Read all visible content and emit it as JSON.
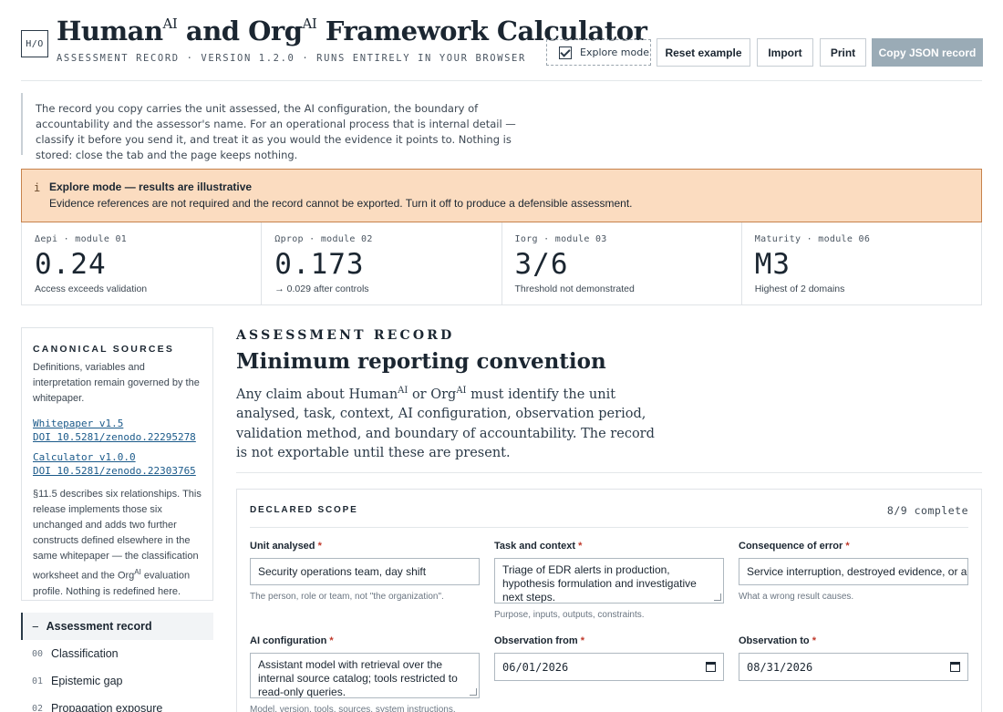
{
  "header": {
    "logo": "H/O",
    "title": {
      "part1": "Human",
      "sup1": "AI",
      "part2": " and Org",
      "sup2": "AI",
      "part3": " Framework Calculator"
    },
    "subtitle": "ASSESSMENT RECORD · VERSION 1.2.0 · RUNS ENTIRELY IN YOUR BROWSER",
    "explore_label": "Explore mode",
    "explore_checked": true,
    "reset_label": "Reset example",
    "import_label": "Import",
    "print_label": "Print",
    "copy_label": "Copy JSON record"
  },
  "intro": "The record you copy carries the unit assessed, the AI configuration, the boundary of accountability and the assessor's name. For an operational process that is internal detail — classify it before you send it, and treat it as you would the evidence it points to. Nothing is stored: close the tab and the page keeps nothing.",
  "warning": {
    "icon": "i",
    "title": "Explore mode — results are illustrative",
    "body": "Evidence references are not required and the record cannot be exported. Turn it off to produce a defensible assessment."
  },
  "metrics": [
    {
      "label": "Δepi · module 01",
      "value": "0.24",
      "note": "Access exceeds validation"
    },
    {
      "label": "Ωprop · module 02",
      "value": "0.173",
      "note": "→ 0.029 after controls"
    },
    {
      "label": "Iorg · module 03",
      "value": "3/6",
      "note": "Threshold not demonstrated"
    },
    {
      "label": "Maturity · module 06",
      "value": "M3",
      "note": "Highest of 2 domains"
    }
  ],
  "sources": {
    "heading": "CANONICAL SOURCES",
    "desc": "Definitions, variables and interpretation remain governed by the whitepaper.",
    "link1_line1": "Whitepaper v1.5",
    "link1_line2": "DOI 10.5281/zenodo.22295278",
    "link2_line1": "Calculator v1.0.0",
    "link2_line2": "DOI 10.5281/zenodo.22303765",
    "desc2_a": "§11.5 describes six relationships. This release implements those six unchanged and adds two further constructs defined elsewhere in the same whitepaper — the classification worksheet and the Org",
    "desc2_sup": "AI",
    "desc2_b": " evaluation profile. Nothing is redefined here."
  },
  "nav": {
    "active": "Assessment record",
    "active_icon": "−",
    "items": [
      {
        "num": "00",
        "label": "Classification"
      },
      {
        "num": "01",
        "label": "Epistemic gap"
      },
      {
        "num": "02",
        "label": "Propagation exposure"
      }
    ]
  },
  "main": {
    "eyebrow": "ASSESSMENT RECORD",
    "title": "Minimum reporting convention",
    "desc_a": "Any claim about Human",
    "desc_sup1": "AI",
    "desc_b": " or Org",
    "desc_sup2": "AI",
    "desc_c": " must identify the unit analysed, task, context, AI configuration, observation period, validation method, and boundary of accountability. The record is not exportable until these are present."
  },
  "scope": {
    "heading": "DECLARED SCOPE",
    "count": "8/9 complete",
    "fields": {
      "unit": {
        "label": "Unit analysed",
        "value": "Security operations team, day shift",
        "hint": "The person, role or team, not \"the organization\"."
      },
      "task": {
        "label": "Task and context",
        "value": "Triage of EDR alerts in production, hypothesis formulation and investigative next steps.",
        "hint": "Purpose, inputs, outputs, constraints."
      },
      "consequence": {
        "label": "Consequence of error",
        "value": "Service interruption, destroyed evidence, or a",
        "hint": "What a wrong result causes."
      },
      "ai_config": {
        "label": "AI configuration",
        "value": "Assistant model with retrieval over the internal source catalog; tools restricted to read-only queries.",
        "hint": "Model, version, tools, sources, system instructions."
      },
      "obs_from": {
        "label": "Observation from",
        "value": "06/01/2026"
      },
      "obs_to": {
        "label": "Observation to",
        "value": "08/31/2026"
      }
    },
    "required_mark": "*"
  }
}
